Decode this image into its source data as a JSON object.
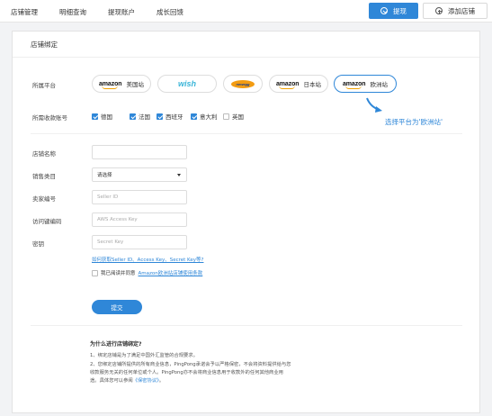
{
  "nav": {
    "items": [
      "店铺管理",
      "明细查询",
      "提现账户",
      "成长回馈"
    ],
    "withdraw_label": "提现",
    "add_store_label": "添加店铺"
  },
  "card": {
    "title": "店铺绑定",
    "platform_label": "所属平台",
    "platforms": [
      {
        "logo": "amazon",
        "name": "美国站",
        "selected": false
      },
      {
        "logo": "wish",
        "name": "",
        "selected": false
      },
      {
        "logo": "newegg",
        "name": "",
        "selected": false
      },
      {
        "logo": "amazon",
        "name": "日本站",
        "selected": false
      },
      {
        "logo": "amazon",
        "name": "欧洲站",
        "selected": true
      }
    ],
    "logo_text": {
      "amazon": "amazon",
      "wish": "wish",
      "newegg": "newegg"
    },
    "annotation": "选择平台为'欧洲站'",
    "account_label": "所需收款账号",
    "countries": [
      {
        "name": "德国",
        "checked": true
      },
      {
        "name": "法国",
        "checked": true
      },
      {
        "name": "西班牙",
        "checked": true
      },
      {
        "name": "意大利",
        "checked": true
      },
      {
        "name": "英国",
        "checked": false
      }
    ],
    "fields": {
      "store_name_label": "店铺名称",
      "category_label": "销售类目",
      "category_value": "请选择",
      "seller_label": "卖家编号",
      "seller_placeholder": "Seller ID",
      "access_label": "访问键编码",
      "access_placeholder": "AWS Access Key",
      "secret_label": "密钥",
      "secret_placeholder": "Secret Key"
    },
    "help_link": "如何获取Seller ID、Access Key、Secret Key等?",
    "agree_text": "我已阅读并同意",
    "agree_link": "Amazon欧洲站店铺使用条款",
    "submit_label": "提交",
    "why": {
      "title": "为什么进行店铺绑定?",
      "line1": "1、绑定店铺是为了满足中国外汇监管的合规要求。",
      "line2": "2、您绑定店铺所提供的所有商业信息，PingPong承诺会予以严格保密，不会将资料提供给与您",
      "line3": "收款服务无关的任何单位或个人。PingPong亦不会将商业信息用于收款外的任何其他商业用",
      "line4_prefix": "途。具体您可以参阅",
      "line4_link": "《保密协议》",
      "line4_suffix": "。"
    }
  },
  "colors": {
    "accent": "#2f87d8",
    "amazon_smile": "#f0a000",
    "wish": "#3ab5d8"
  }
}
